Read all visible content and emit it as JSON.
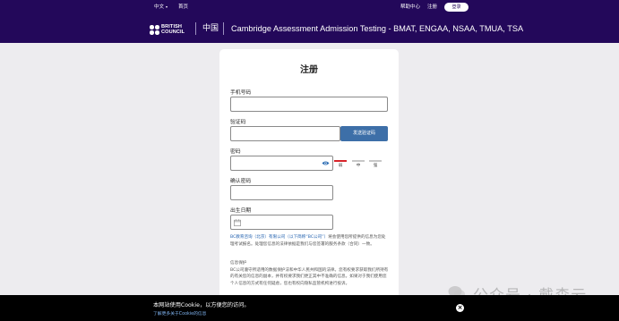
{
  "topbar": {
    "language": "中文",
    "home": "首页",
    "help": "帮助中心",
    "signup": "注册",
    "login": "登录"
  },
  "header": {
    "logo_line1": "BRITISH",
    "logo_line2": "COUNCIL",
    "country": "中国",
    "site_title": "Cambridge Assessment Admission Testing - BMAT, ENGAA, NSAA, TMUA, TSA"
  },
  "form": {
    "title": "注册",
    "phone_label": "手机号码",
    "code_label": "验证码",
    "send_code_button": "发送验证码",
    "password_label": "密码",
    "strength_weak": "弱",
    "strength_medium": "中",
    "strength_strong": "强",
    "confirm_label": "确认密码",
    "dob_label": "出生日期",
    "consent_link": "BC教育咨询（北京）有限公司（以下简称“BC公司”）",
    "consent_text": "将会使用您所提供的信息为您处理考试报名。处理您信息的法律依据是我们与您签署的服务条款（合同）一致。",
    "privacy_title": "信息保护",
    "privacy_text": "BC公司遵守所适用的数据保护法和中华人民共和国的法律。您有权要求获取我们所持有的有关您的信息的副本，并有权要求我们更正其中不准确的信息。如果对于我们使用您个人信息的方式有任何疑虑，您也有权向隐私监管机构进行投诉。"
  },
  "cookie": {
    "text": "本网站使用Cookie，以方便您的访问。",
    "link": "了解更多关于Cookie的信息"
  },
  "watermark": {
    "text": "公众号 · 戴森云"
  }
}
